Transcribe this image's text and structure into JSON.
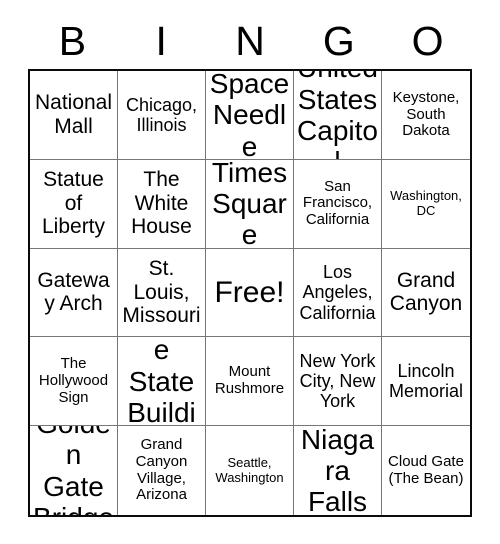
{
  "header": {
    "letters": [
      "B",
      "I",
      "N",
      "G",
      "O"
    ]
  },
  "grid": {
    "rows": 5,
    "columns": 5,
    "cells": [
      {
        "text": "National Mall",
        "size": "lg"
      },
      {
        "text": "Chicago, Illinois",
        "size": "md"
      },
      {
        "text": "Space Needle",
        "size": "xl"
      },
      {
        "text": "United States Capitol",
        "size": "xl"
      },
      {
        "text": "Keystone, South Dakota",
        "size": "sm"
      },
      {
        "text": "Statue of Liberty",
        "size": "lg"
      },
      {
        "text": "The White House",
        "size": "lg"
      },
      {
        "text": "Times Square",
        "size": "xl"
      },
      {
        "text": "San Francisco, California",
        "size": "sm"
      },
      {
        "text": "Washington, DC",
        "size": "xs"
      },
      {
        "text": "Gateway Arch",
        "size": "lg"
      },
      {
        "text": "St. Louis, Missouri",
        "size": "lg"
      },
      {
        "text": "Free!",
        "size": "free"
      },
      {
        "text": "Los Angeles, California",
        "size": "md"
      },
      {
        "text": "Grand Canyon",
        "size": "lg"
      },
      {
        "text": "The Hollywood Sign",
        "size": "sm"
      },
      {
        "text": "Empire State Building",
        "size": "xl"
      },
      {
        "text": "Mount Rushmore",
        "size": "sm"
      },
      {
        "text": "New York City, New York",
        "size": "md"
      },
      {
        "text": "Lincoln Memorial",
        "size": "md"
      },
      {
        "text": "Golden Gate Bridge",
        "size": "xl"
      },
      {
        "text": "Grand Canyon Village, Arizona",
        "size": "sm"
      },
      {
        "text": "Seattle, Washington",
        "size": "xs"
      },
      {
        "text": "Niagara Falls",
        "size": "xl"
      },
      {
        "text": "Cloud Gate (The Bean)",
        "size": "sm"
      }
    ]
  }
}
